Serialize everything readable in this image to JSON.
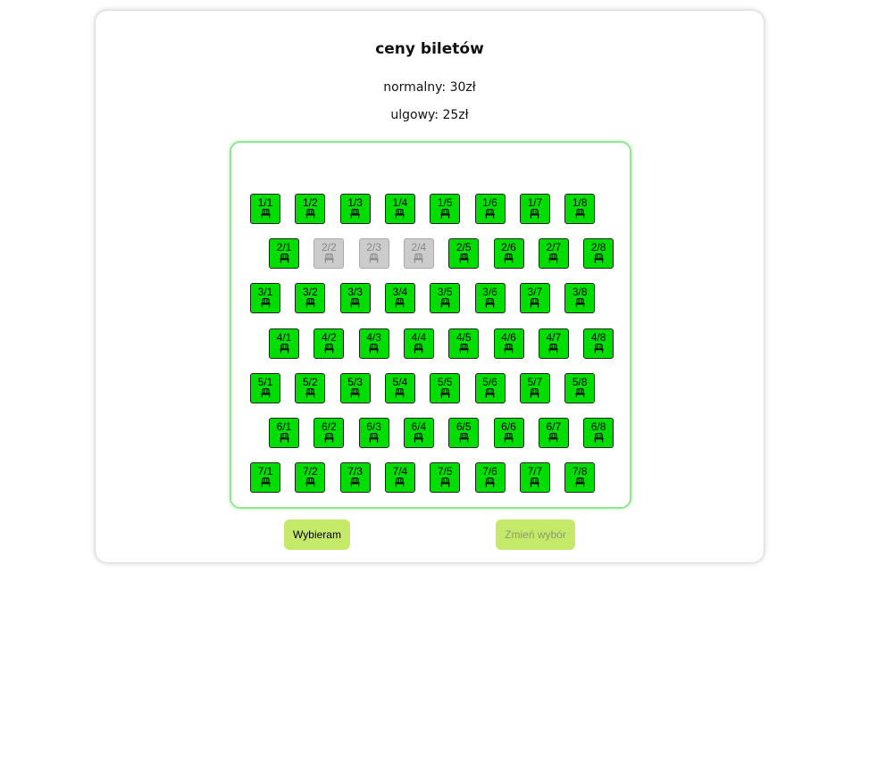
{
  "page": {
    "title": "ceny biletów",
    "price_normal": "normalny: 30zł",
    "price_reduced": "ulgowy: 25zł"
  },
  "seat_icon": "armchair-icon",
  "colors": {
    "free_seat": "#00dd00",
    "taken_seat": "#cccccc",
    "button": "#c5ea6a",
    "hall_border": "#90e890"
  },
  "rows": [
    {
      "row": 1,
      "seats": [
        {
          "label": "1/1",
          "taken": false
        },
        {
          "label": "1/2",
          "taken": false
        },
        {
          "label": "1/3",
          "taken": false
        },
        {
          "label": "1/4",
          "taken": false
        },
        {
          "label": "1/5",
          "taken": false
        },
        {
          "label": "1/6",
          "taken": false
        },
        {
          "label": "1/7",
          "taken": false
        },
        {
          "label": "1/8",
          "taken": false
        }
      ]
    },
    {
      "row": 2,
      "seats": [
        {
          "label": "2/1",
          "taken": false
        },
        {
          "label": "2/2",
          "taken": true
        },
        {
          "label": "2/3",
          "taken": true
        },
        {
          "label": "2/4",
          "taken": true
        },
        {
          "label": "2/5",
          "taken": false
        },
        {
          "label": "2/6",
          "taken": false
        },
        {
          "label": "2/7",
          "taken": false
        },
        {
          "label": "2/8",
          "taken": false
        }
      ]
    },
    {
      "row": 3,
      "seats": [
        {
          "label": "3/1",
          "taken": false
        },
        {
          "label": "3/2",
          "taken": false
        },
        {
          "label": "3/3",
          "taken": false
        },
        {
          "label": "3/4",
          "taken": false
        },
        {
          "label": "3/5",
          "taken": false
        },
        {
          "label": "3/6",
          "taken": false
        },
        {
          "label": "3/7",
          "taken": false
        },
        {
          "label": "3/8",
          "taken": false
        }
      ]
    },
    {
      "row": 4,
      "seats": [
        {
          "label": "4/1",
          "taken": false
        },
        {
          "label": "4/2",
          "taken": false
        },
        {
          "label": "4/3",
          "taken": false
        },
        {
          "label": "4/4",
          "taken": false
        },
        {
          "label": "4/5",
          "taken": false
        },
        {
          "label": "4/6",
          "taken": false
        },
        {
          "label": "4/7",
          "taken": false
        },
        {
          "label": "4/8",
          "taken": false
        }
      ]
    },
    {
      "row": 5,
      "seats": [
        {
          "label": "5/1",
          "taken": false
        },
        {
          "label": "5/2",
          "taken": false
        },
        {
          "label": "5/3",
          "taken": false
        },
        {
          "label": "5/4",
          "taken": false
        },
        {
          "label": "5/5",
          "taken": false
        },
        {
          "label": "5/6",
          "taken": false
        },
        {
          "label": "5/7",
          "taken": false
        },
        {
          "label": "5/8",
          "taken": false
        }
      ]
    },
    {
      "row": 6,
      "seats": [
        {
          "label": "6/1",
          "taken": false
        },
        {
          "label": "6/2",
          "taken": false
        },
        {
          "label": "6/3",
          "taken": false
        },
        {
          "label": "6/4",
          "taken": false
        },
        {
          "label": "6/5",
          "taken": false
        },
        {
          "label": "6/6",
          "taken": false
        },
        {
          "label": "6/7",
          "taken": false
        },
        {
          "label": "6/8",
          "taken": false
        }
      ]
    },
    {
      "row": 7,
      "seats": [
        {
          "label": "7/1",
          "taken": false
        },
        {
          "label": "7/2",
          "taken": false
        },
        {
          "label": "7/3",
          "taken": false
        },
        {
          "label": "7/4",
          "taken": false
        },
        {
          "label": "7/5",
          "taken": false
        },
        {
          "label": "7/6",
          "taken": false
        },
        {
          "label": "7/7",
          "taken": false
        },
        {
          "label": "7/8",
          "taken": false
        }
      ]
    }
  ],
  "buttons": {
    "choose_label": "Wybieram",
    "change_label": "Zmień wybór"
  }
}
